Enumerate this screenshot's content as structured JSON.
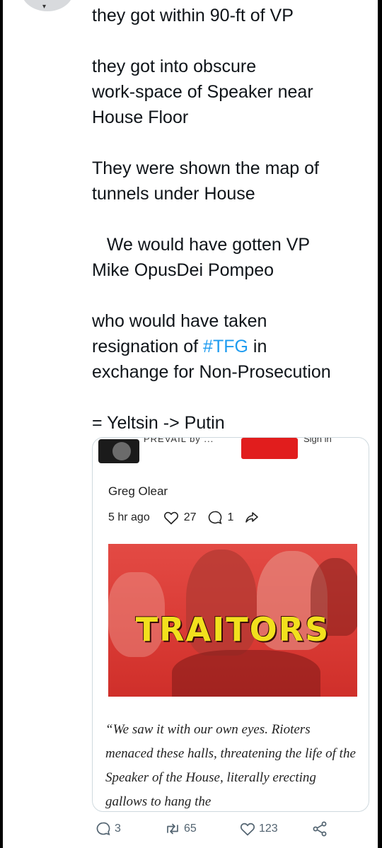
{
  "tweet": {
    "paragraphs": [
      "they got within 90-ft of VP",
      "they got into obscure\nwork-space of Speaker near\nHouse Floor",
      "They were shown the map of\ntunnels under House",
      "   We would have gotten VP\nMike OpusDei Pompeo"
    ],
    "p5_before": "who would have taken\nresignation of ",
    "hashtag": "#TFG",
    "p5_after": " in\nexchange for Non-Prosecution",
    "last_line": "= Yeltsin -> Putin"
  },
  "card": {
    "pub_name": "PREVAIL by ...",
    "sign_in": "Sign in",
    "author": "Greg Olear",
    "time": "5 hr ago",
    "likes": "27",
    "comments": "1",
    "image_text": "TRAITORS",
    "quote": "“We saw it with our own eyes. Rioters menaced these halls, threatening the life of the Speaker of the House, literally erecting gallows to hang the"
  },
  "actions": {
    "replies": "3",
    "retweets": "65",
    "likes": "123"
  },
  "colors": {
    "link": "#1d9bf0",
    "accent_red": "#e11d1d",
    "headline_yellow": "#f2e01d",
    "secondary_text": "#536471"
  }
}
